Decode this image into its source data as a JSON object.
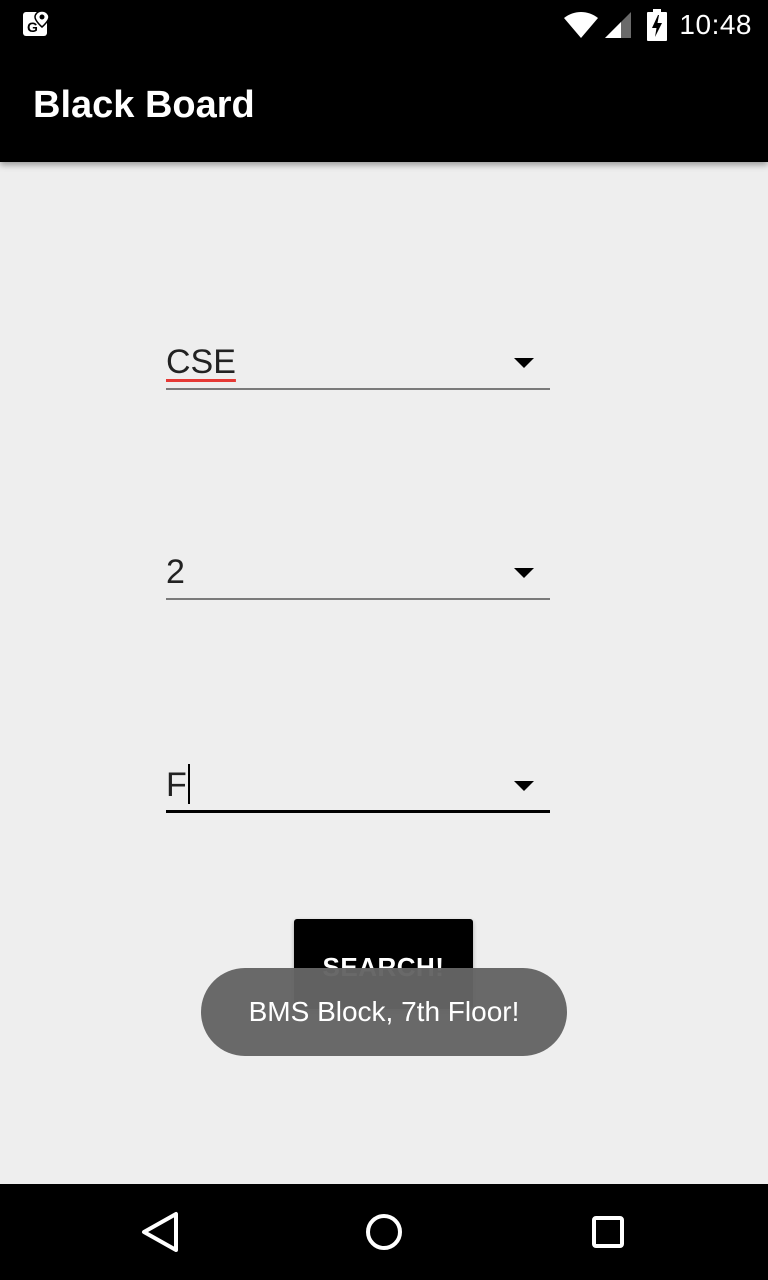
{
  "status_bar": {
    "time": "10:48",
    "icons": [
      "location-notification-icon",
      "wifi-icon",
      "cellular-signal-icon",
      "battery-charging-icon"
    ]
  },
  "app_bar": {
    "title": "Black Board"
  },
  "form": {
    "department": "CSE",
    "semester": "2",
    "section": "F",
    "search_label": "SEARCH!"
  },
  "toast": {
    "message": "BMS Block, 7th Floor!"
  },
  "nav_bar": {
    "icons": [
      "back-icon",
      "home-icon",
      "recents-icon"
    ]
  },
  "colors": {
    "app_bar": "#000000",
    "background": "#eeeeee",
    "spell_underline": "#e53935",
    "toast": "#646464"
  }
}
